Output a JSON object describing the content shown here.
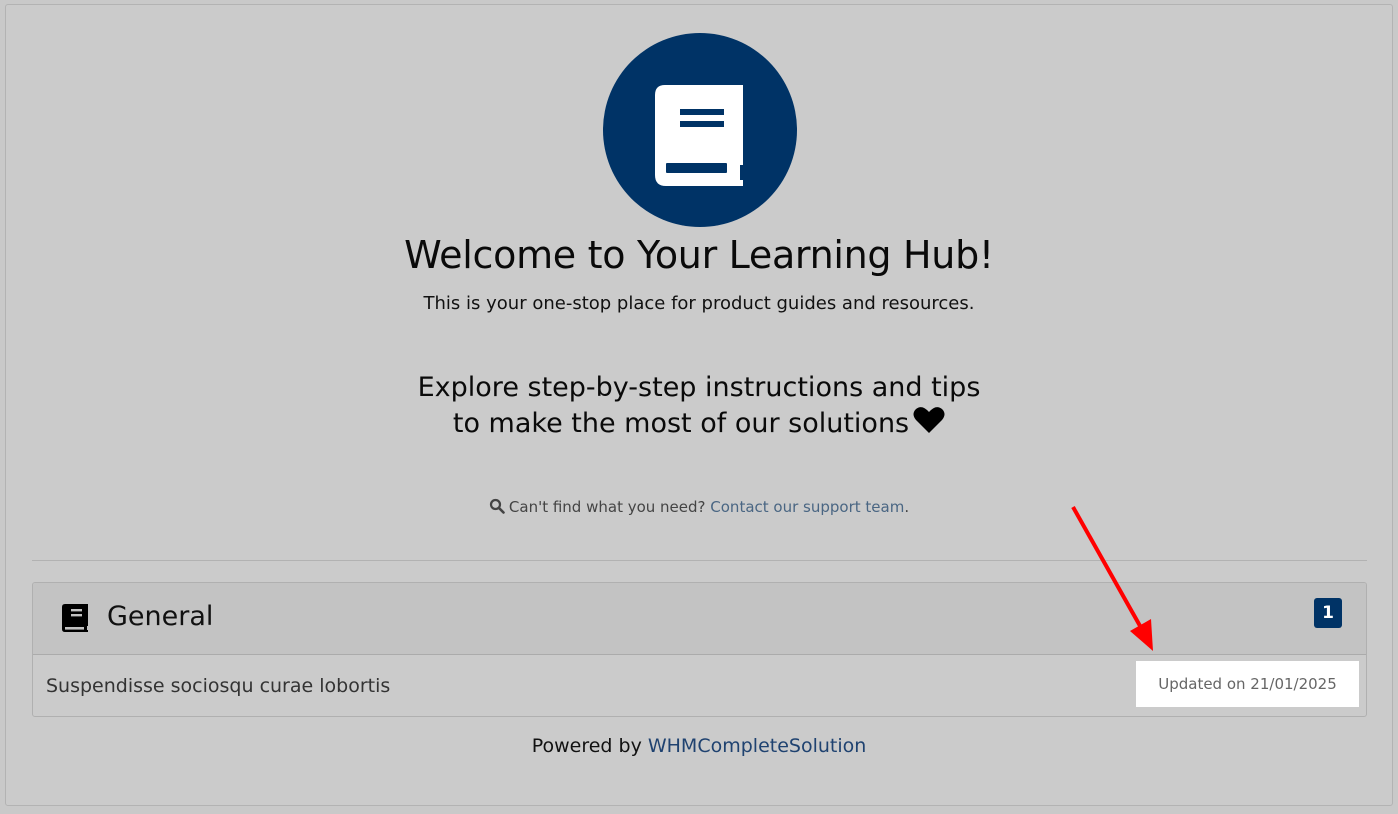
{
  "hero": {
    "icon": "book-icon",
    "title": "Welcome to Your Learning Hub!",
    "subtitle": "This is your one-stop place for product guides and resources."
  },
  "tagline": {
    "line1": "Explore step-by-step instructions and tips",
    "line2": "to make the most of our solutions",
    "icon": "heart-icon"
  },
  "help": {
    "icon": "search-icon",
    "text": "Can't find what you need?",
    "link": "Contact our support team",
    "suffix": "."
  },
  "category": {
    "icon": "book-icon",
    "title": "General",
    "count": "1",
    "articles": [
      {
        "title": "Suspendisse sociosqu curae lobortis",
        "updated": "Updated on 21/01/2025"
      }
    ]
  },
  "footer": {
    "prefix": "Powered by",
    "link": "WHMCompleteSolution"
  },
  "colors": {
    "brand": "#003366",
    "link": "#4a6683",
    "annotation_arrow": "#ff0000"
  }
}
